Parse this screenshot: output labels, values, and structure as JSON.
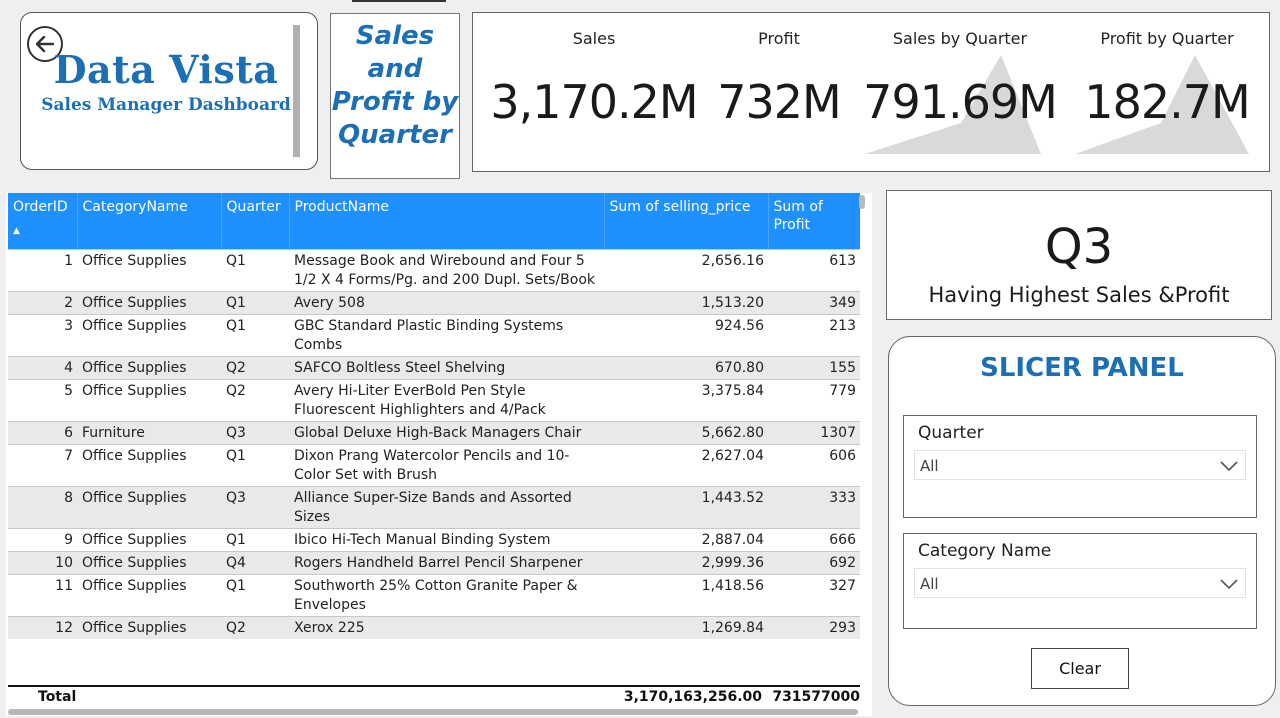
{
  "brand": {
    "title": "Data Vista",
    "subtitle": "Sales Manager Dashboard"
  },
  "report_title": [
    "Sales",
    "and",
    "Profit by",
    "Quarter"
  ],
  "kpis": [
    {
      "label": "Sales",
      "value": "3,170.2M"
    },
    {
      "label": "Profit",
      "value": "732M"
    },
    {
      "label": "Sales by Quarter",
      "value": "791.69M"
    },
    {
      "label": "Profit by Quarter",
      "value": "182.7M"
    }
  ],
  "table": {
    "columns": [
      "OrderID",
      "CategoryName",
      "Quarter",
      "ProductName",
      "Sum of selling_price",
      "Sum of Profit"
    ],
    "sort_indicator": "▲",
    "rows": [
      {
        "id": "1",
        "category": "Office Supplies",
        "quarter": "Q1",
        "product": "Message Book and Wirebound and Four 5 1/2 X 4 Forms/Pg. and 200 Dupl. Sets/Book",
        "price": "2,656.16",
        "profit": "613"
      },
      {
        "id": "2",
        "category": "Office Supplies",
        "quarter": "Q1",
        "product": "Avery 508",
        "price": "1,513.20",
        "profit": "349"
      },
      {
        "id": "3",
        "category": "Office Supplies",
        "quarter": "Q1",
        "product": "GBC Standard Plastic Binding Systems Combs",
        "price": "924.56",
        "profit": "213"
      },
      {
        "id": "4",
        "category": "Office Supplies",
        "quarter": "Q2",
        "product": "SAFCO Boltless Steel Shelving",
        "price": "670.80",
        "profit": "155"
      },
      {
        "id": "5",
        "category": "Office Supplies",
        "quarter": "Q2",
        "product": "Avery Hi-Liter EverBold Pen Style Fluorescent Highlighters and 4/Pack",
        "price": "3,375.84",
        "profit": "779"
      },
      {
        "id": "6",
        "category": "Furniture",
        "quarter": "Q3",
        "product": "Global Deluxe High-Back Managers Chair",
        "price": "5,662.80",
        "profit": "1307"
      },
      {
        "id": "7",
        "category": "Office Supplies",
        "quarter": "Q1",
        "product": "Dixon Prang Watercolor Pencils and 10-Color Set with Brush",
        "price": "2,627.04",
        "profit": "606"
      },
      {
        "id": "8",
        "category": "Office Supplies",
        "quarter": "Q3",
        "product": "Alliance Super-Size Bands and Assorted Sizes",
        "price": "1,443.52",
        "profit": "333"
      },
      {
        "id": "9",
        "category": "Office Supplies",
        "quarter": "Q1",
        "product": "Ibico Hi-Tech Manual Binding System",
        "price": "2,887.04",
        "profit": "666"
      },
      {
        "id": "10",
        "category": "Office Supplies",
        "quarter": "Q4",
        "product": "Rogers Handheld Barrel Pencil Sharpener",
        "price": "2,999.36",
        "profit": "692"
      },
      {
        "id": "11",
        "category": "Office Supplies",
        "quarter": "Q1",
        "product": "Southworth 25% Cotton Granite Paper & Envelopes",
        "price": "1,418.56",
        "profit": "327"
      },
      {
        "id": "12",
        "category": "Office Supplies",
        "quarter": "Q2",
        "product": "Xerox 225",
        "price": "1,269.84",
        "profit": "293"
      }
    ],
    "total": {
      "label": "Total",
      "price": "3,170,163,256.00",
      "profit": "731577000"
    }
  },
  "highlight": {
    "value": "Q3",
    "caption": "Having Highest Sales &Profit"
  },
  "slicer_panel": {
    "title": "SLICER PANEL",
    "slicers": [
      {
        "label": "Quarter",
        "value": "All"
      },
      {
        "label": "Category Name",
        "value": "All"
      }
    ],
    "clear_label": "Clear"
  },
  "colors": {
    "accent": "#1c6fb5",
    "header": "#1e90ff",
    "sparkline": "#d9d9d9"
  },
  "icons": {
    "back": "back-arrow-icon",
    "dropdown": "chevron-down-icon"
  }
}
